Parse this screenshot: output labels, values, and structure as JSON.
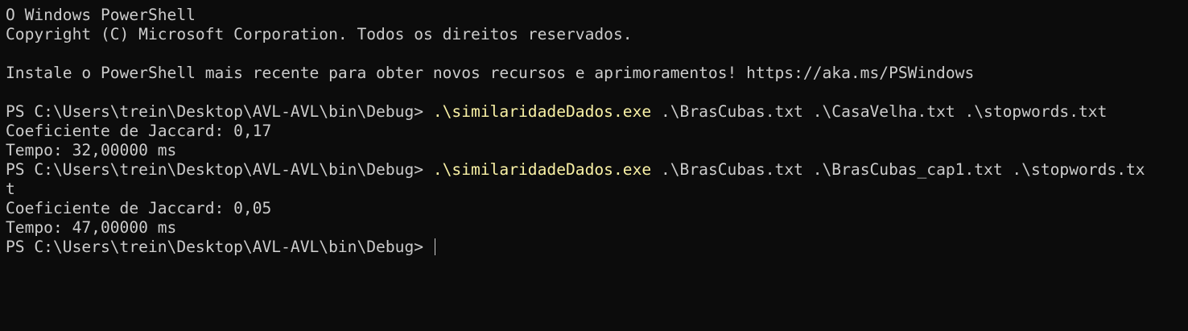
{
  "terminal": {
    "banner": {
      "title": "O Windows PowerShell",
      "copyright": "Copyright (C) Microsoft Corporation. Todos os direitos reservados.",
      "notice": "Instale o PowerShell mais recente para obter novos recursos e aprimoramentos! https://aka.ms/PSWindows"
    },
    "prompt": "PS C:\\Users\\trein\\Desktop\\AVL-AVL\\bin\\Debug> ",
    "runs": [
      {
        "command": ".\\similaridadeDados.exe",
        "args": " .\\BrasCubas.txt .\\CasaVelha.txt .\\stopwords.txt",
        "args_wrap": "",
        "jaccard": "Coeficiente de Jaccard: 0,17",
        "time": "Tempo: 32,00000 ms"
      },
      {
        "command": ".\\similaridadeDados.exe",
        "args": " .\\BrasCubas.txt .\\BrasCubas_cap1.txt .\\stopwords.tx",
        "args_wrap": "t",
        "jaccard": "Coeficiente de Jaccard: 0,05",
        "time": "Tempo: 47,00000 ms"
      }
    ],
    "colors": {
      "background": "#0c0c0c",
      "foreground": "#cccccc",
      "command": "#f9f1a5"
    }
  }
}
